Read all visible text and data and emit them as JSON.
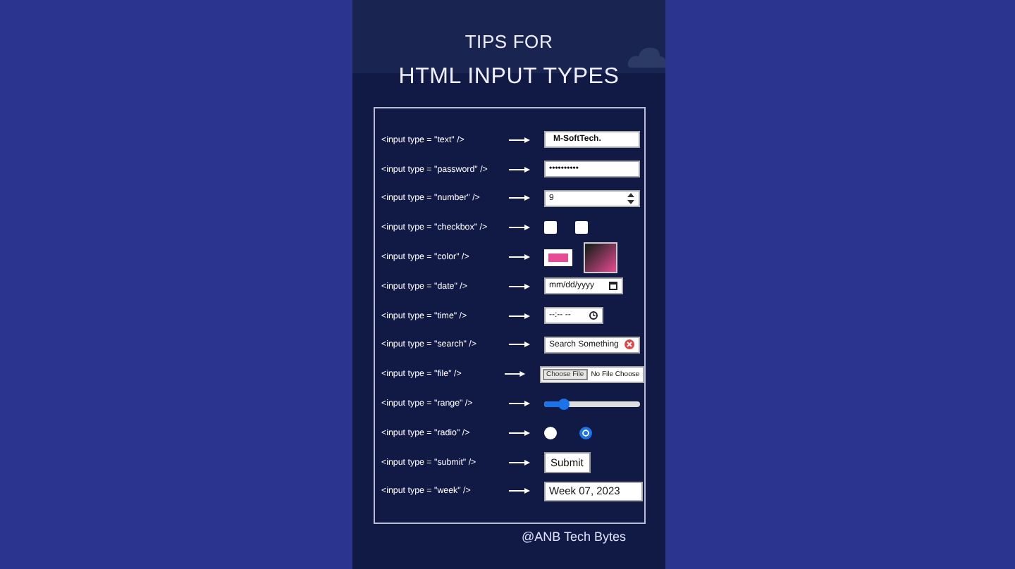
{
  "title": {
    "line_1": "TIPS FOR",
    "line_2": "HTML INPUT TYPES"
  },
  "rows": [
    {
      "kind": "text",
      "code": "<input type = \"text\" />",
      "value": "M-SoftTech."
    },
    {
      "kind": "password",
      "code": "<input type = \"password\" />",
      "value": "••••••••••"
    },
    {
      "kind": "number",
      "code": "<input type = \"number\" />",
      "value": "9"
    },
    {
      "kind": "checkbox",
      "code": "<input type = \"checkbox\" />",
      "boxes": [
        {
          "checked": false
        },
        {
          "checked": false
        }
      ]
    },
    {
      "kind": "color",
      "code": "<input type = \"color\" />",
      "color": "#e84a93"
    },
    {
      "kind": "date",
      "code": "<input type = \"date\" />",
      "placeholder": "mm/dd/yyyy"
    },
    {
      "kind": "time",
      "code": "<input type = \"time\" />",
      "placeholder": "--:-- --"
    },
    {
      "kind": "search",
      "code": "<input type = \"search\" />",
      "value": "Search Something"
    },
    {
      "kind": "file",
      "code": "<input type = \"file\" />",
      "button": "Choose File",
      "status": "No File Choose"
    },
    {
      "kind": "range",
      "code": "<input type = \"range\" />",
      "level": 0.22
    },
    {
      "kind": "radio",
      "code": "<input type = \"radio\" />",
      "options": [
        {
          "selected": false
        },
        {
          "selected": true
        }
      ]
    },
    {
      "kind": "submit",
      "code": "<input type = \"submit\" />",
      "label": "Submit"
    },
    {
      "kind": "week",
      "code": "<input type = \"week\" />",
      "value": "Week 07, 2023"
    }
  ],
  "credit": "@ANB Tech Bytes"
}
